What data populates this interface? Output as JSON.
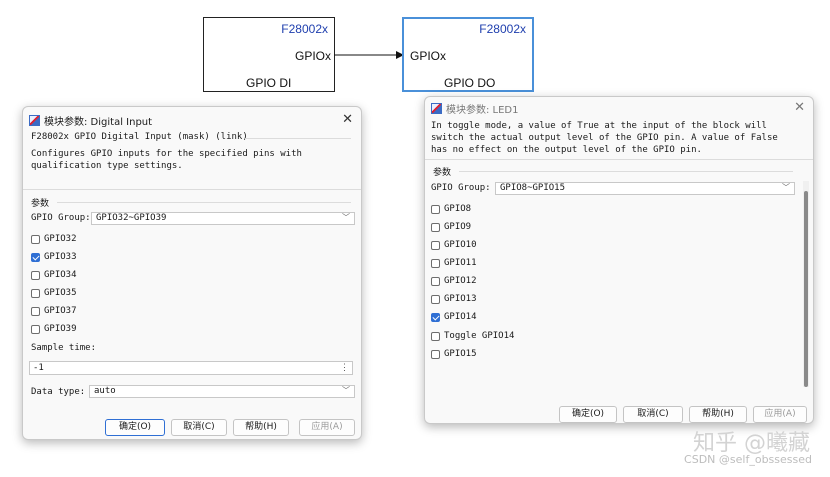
{
  "blocks": {
    "di": {
      "model": "F28002x",
      "port": "GPIOx",
      "name": "GPIO DI"
    },
    "do": {
      "model": "F28002x",
      "port": "GPIOx",
      "name": "GPIO DO"
    }
  },
  "dialog_di": {
    "title": "模块参数: Digital Input",
    "mask_header": "F28002x GPIO Digital Input (mask) (link)",
    "description_lines": [
      "Configures GPIO inputs for the specified pins with",
      "qualification type settings."
    ],
    "section_label": "参数",
    "group_label": "GPIO Group:",
    "group_value": "GPIO32~GPIO39",
    "checkboxes": [
      {
        "label": "GPIO32",
        "checked": false
      },
      {
        "label": "GPIO33",
        "checked": true
      },
      {
        "label": "GPIO34",
        "checked": false
      },
      {
        "label": "GPIO35",
        "checked": false
      },
      {
        "label": "GPIO37",
        "checked": false
      },
      {
        "label": "GPIO39",
        "checked": false
      }
    ],
    "sample_time_label": "Sample time:",
    "sample_time_value": "-1",
    "data_type_label": "Data type:",
    "data_type_value": "auto",
    "buttons": {
      "ok": "确定(O)",
      "cancel": "取消(C)",
      "help": "帮助(H)",
      "apply": "应用(A)"
    }
  },
  "dialog_do": {
    "title": "模块参数: LED1",
    "description_lines": [
      "In toggle mode, a value of True at the input of the block will",
      "switch the actual output level of the GPIO pin. A value of False",
      "has no effect on the output level of the GPIO pin."
    ],
    "section_label": "参数",
    "group_label": "GPIO Group:",
    "group_value": "GPIO8~GPIO15",
    "checkboxes": [
      {
        "label": "GPIO8",
        "checked": false
      },
      {
        "label": "GPIO9",
        "checked": false
      },
      {
        "label": "GPIO10",
        "checked": false
      },
      {
        "label": "GPIO11",
        "checked": false
      },
      {
        "label": "GPIO12",
        "checked": false
      },
      {
        "label": "GPIO13",
        "checked": false
      },
      {
        "label": "GPIO14",
        "checked": true
      },
      {
        "label": "Toggle GPIO14",
        "checked": false
      },
      {
        "label": "GPIO15",
        "checked": false
      }
    ],
    "buttons": {
      "ok": "确定(O)",
      "cancel": "取消(C)",
      "help": "帮助(H)",
      "apply": "应用(A)"
    }
  },
  "watermark": {
    "main": "知乎 @曦藏",
    "sub": "CSDN @self_obssessed"
  },
  "icons": {
    "close": "close-icon",
    "chevron": "chevron-down-icon",
    "spinner": "spinner-icon",
    "app": "simulink-app-icon"
  },
  "colors": {
    "accent": "#2f6fd4",
    "block_text": "#1f3fae",
    "block_selected": "#4a90d9"
  }
}
